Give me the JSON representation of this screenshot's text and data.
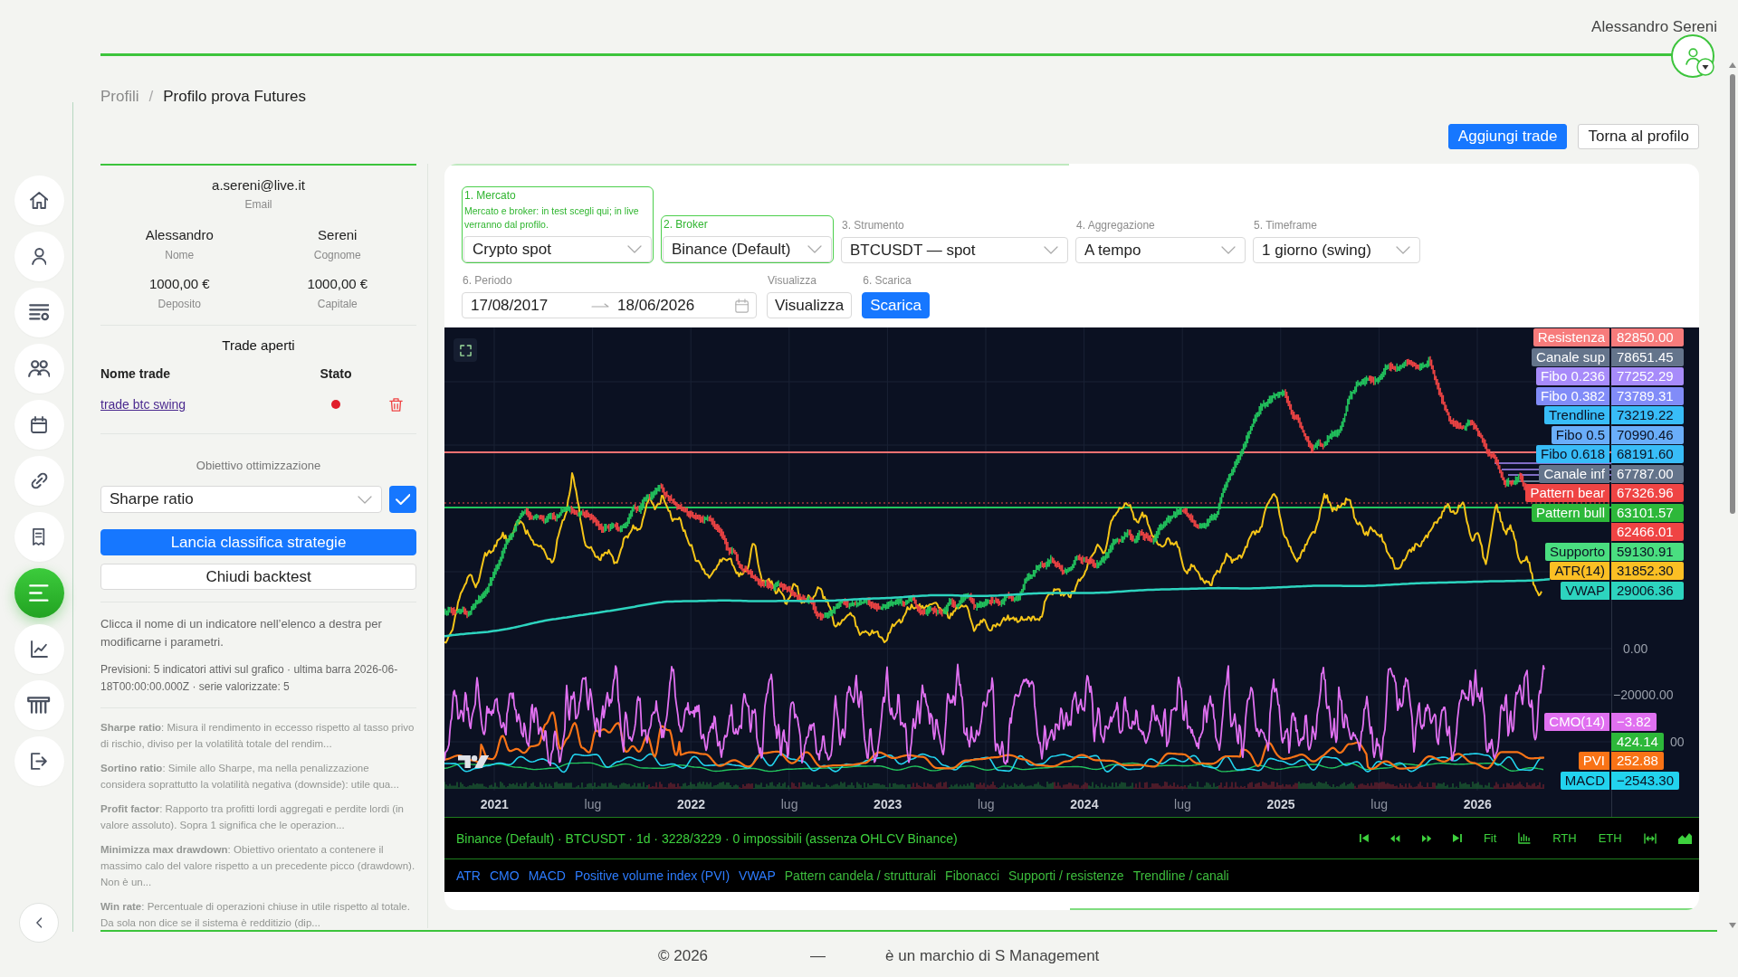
{
  "header": {
    "user_name": "Alessandro Sereni"
  },
  "sidebar": {
    "items": [
      {
        "selected": false
      },
      {
        "selected": false
      },
      {
        "selected": false
      },
      {
        "selected": false
      },
      {
        "selected": false
      },
      {
        "selected": false
      },
      {
        "selected": false
      },
      {
        "selected": true
      },
      {
        "selected": false
      },
      {
        "selected": false
      },
      {
        "selected": false
      }
    ]
  },
  "breadcrumb": {
    "separator": "/",
    "items": [
      {
        "label": "Profili",
        "current": false
      },
      {
        "label": "Profilo prova Futures",
        "current": true
      }
    ]
  },
  "actions": [
    {
      "label": "Aggiungi trade",
      "primary": true
    },
    {
      "label": "Torna al profilo",
      "primary": false
    }
  ],
  "profile": {
    "fields": [
      {
        "value": "a.sereni@live.it",
        "label": "Email"
      },
      {
        "value": "Alessandro",
        "label": "Nome"
      },
      {
        "value": "Sereni",
        "label": "Cognome"
      },
      {
        "value": "1000,00 €",
        "label": "Deposito"
      },
      {
        "value": "1000,00 €",
        "label": "Capitale"
      }
    ]
  },
  "open_trades": {
    "title": "Trade aperti",
    "columns": [
      "Nome trade",
      "Stato"
    ],
    "rows": [
      {
        "name": "trade btc swing",
        "color": "#e11d2a"
      }
    ]
  },
  "optimization": {
    "label": "Obiettivo ottimizzazione",
    "value": "Sharpe ratio",
    "run_button": "Lancia classifica strategie",
    "close_button": "Chiudi backtest"
  },
  "notes": [
    "Clicca il nome di un indicatore nell’elenco a destra per modificarne i parametri.",
    "Previsioni: 5 indicatori attivi sul grafico · ultima barra 2026-06-18T00:00:00.000Z · serie valorizzate: 5"
  ],
  "objectives": [
    "**Sharpe ratio**: Misura il rendimento in eccesso rispetto al tasso privo di rischio, diviso per la volatilità totale del rendim...",
    "**Sortino ratio**: Simile allo Sharpe, ma nella penalizzazione considera soprattutto la volatilità negativa (downside): utile qua...",
    "**Profit factor**: Rapporto tra profitti lordi aggregati e perdite lordi (in valore assoluto). Sopra 1 significa che le operazion...",
    "**Minimizza max drawdown**: Obiettivo orientato a contenere il massimo calo del valore rispetto a un precedente picco (drawdown). Non è un...",
    "**Win rate**: Percentuale di operazioni chiuse in utile rispetto al totale. Da sola non dice se il sistema è redditizio (dip..."
  ],
  "form": {
    "fields": [
      {
        "label": "1. Mercato",
        "hint": "Mercato e broker: in test scegli qui; in live verranno dal profilo.",
        "value": "Crypto spot",
        "highlighted": true
      },
      {
        "label": "2. Broker",
        "value": "Binance (Default)",
        "highlighted": true
      },
      {
        "label": "3. Strumento",
        "value": "BTCUSDT — spot",
        "highlighted": false
      },
      {
        "label": "4. Aggregazione",
        "value": "A tempo",
        "highlighted": false
      },
      {
        "label": "5. Timeframe",
        "value": "1 giorno (swing)",
        "highlighted": false
      }
    ],
    "period": {
      "label": "6. Periodo",
      "start": "17/08/2017",
      "end": "18/06/2026"
    },
    "view": {
      "label": "Visualizza",
      "button": "Visualizza"
    },
    "download": {
      "label": "6. Scarica",
      "button": "Scarica"
    }
  },
  "chart": {
    "time_labels": [
      {
        "label": "2021",
        "kind": "year"
      },
      {
        "label": "lug",
        "kind": "month"
      },
      {
        "label": "2022",
        "kind": "year"
      },
      {
        "label": "lug",
        "kind": "month"
      },
      {
        "label": "2023",
        "kind": "year"
      },
      {
        "label": "lug",
        "kind": "month"
      },
      {
        "label": "2024",
        "kind": "year"
      },
      {
        "label": "lug",
        "kind": "month"
      },
      {
        "label": "2025",
        "kind": "year"
      },
      {
        "label": "lug",
        "kind": "month"
      },
      {
        "label": "2026",
        "kind": "year"
      }
    ],
    "axis_labels": [
      "0.00",
      "−20000.00",
      "00"
    ],
    "price_tags": [
      {
        "name": "Resistenza",
        "value": "82850.00",
        "color": "#f77b7b"
      },
      {
        "name": "Canale sup",
        "value": "78651.45",
        "color": "#64748b"
      },
      {
        "name": "Fibo 0.236",
        "value": "77252.29",
        "color": "#a78bfa"
      },
      {
        "name": "Fibo 0.382",
        "value": "73789.31",
        "color": "#818cf8"
      },
      {
        "name": "Trendline",
        "value": "73219.22",
        "color": "#38bdf8"
      },
      {
        "name": "Fibo 0.5",
        "value": "70990.46",
        "color": "#6aaefa"
      },
      {
        "name": "Fibo 0.618",
        "value": "68191.60",
        "color": "#38bdf8"
      },
      {
        "name": "Canale inf",
        "value": "67787.00",
        "color": "#64748b"
      },
      {
        "name": "Pattern bear",
        "value": "67326.96",
        "color": "#ef4444"
      },
      {
        "name": "Pattern bull",
        "value": "63101.57",
        "color": "#2db83a"
      },
      {
        "value": "62466.01",
        "color": "#ef4444"
      },
      {
        "name": "Supporto",
        "value": "59130.91",
        "color": "#4ade80"
      },
      {
        "name": "ATR(14)",
        "value": "31852.30",
        "color": "#fbbf24"
      },
      {
        "name": "VWAP",
        "value": "29006.36",
        "color": "#2dd4bf"
      }
    ],
    "indicator_tags": [
      {
        "name": "CMO(14)",
        "value": "−3.82",
        "color": "#e070f0"
      },
      {
        "value": "424.14",
        "color": "#2db83a"
      },
      {
        "name": "PVI",
        "value": "252.88",
        "color": "#f97316"
      },
      {
        "name": "MACD",
        "value": "−2543.30",
        "color": "#22d3ee"
      }
    ]
  },
  "status_bar": {
    "text": "Binance (Default) · BTCUSDT · 1d · 3228/3229 · 0 impossibili (assenza OHLCV Binance)",
    "controls": [
      {
        "kind": "icon"
      },
      {
        "kind": "icon"
      },
      {
        "kind": "icon"
      },
      {
        "kind": "icon"
      },
      {
        "kind": "text",
        "label": "Fit"
      },
      {
        "kind": "icon"
      },
      {
        "kind": "text",
        "label": "RTH"
      },
      {
        "kind": "text",
        "label": "ETH"
      },
      {
        "kind": "icon"
      },
      {
        "kind": "icon"
      }
    ]
  },
  "indicators": [
    {
      "label": "ATR",
      "active": true
    },
    {
      "label": "CMO",
      "active": true
    },
    {
      "label": "MACD",
      "active": true
    },
    {
      "label": "Positive volume index (PVI)",
      "active": true
    },
    {
      "label": "VWAP",
      "active": true
    },
    {
      "label": "Pattern candela / strutturali",
      "active": false
    },
    {
      "label": "Fibonacci",
      "active": false
    },
    {
      "label": "Supporti / resistenze",
      "active": false
    },
    {
      "label": "Trendline / canali",
      "active": false
    }
  ],
  "footer": [
    "© 2026",
    "—",
    "è un marchio di S Management"
  ]
}
